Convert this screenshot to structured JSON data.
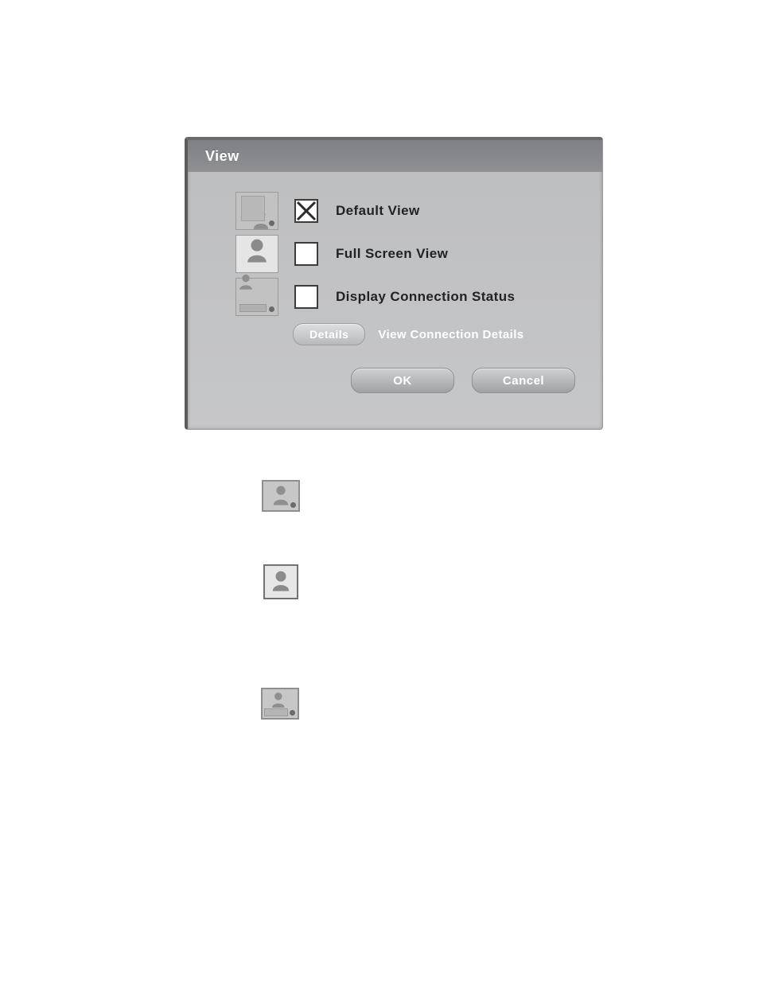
{
  "dialog": {
    "title": "View",
    "options": [
      {
        "label": "Default View",
        "checked": true
      },
      {
        "label": "Full Screen View",
        "checked": false
      },
      {
        "label": "Display Connection Status",
        "checked": false
      }
    ],
    "details_button": "Details",
    "details_label": "View Connection Details",
    "ok_label": "OK",
    "cancel_label": "Cancel"
  }
}
